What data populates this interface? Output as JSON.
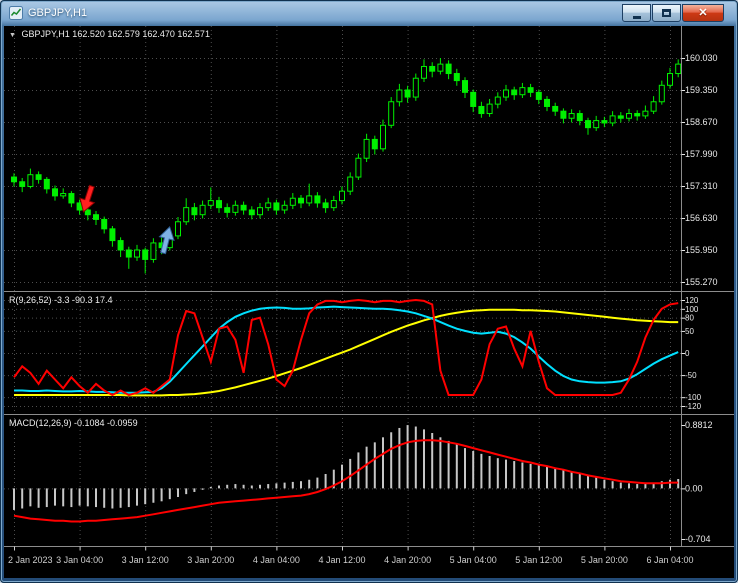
{
  "window": {
    "title": "GBPJPY,H1"
  },
  "icons": {
    "dropdown": "▼",
    "close": "✕"
  },
  "chart": {
    "info_line": "GBPJPY,H1 162.520 162.579 162.470 162.571"
  },
  "panels": {
    "indicator1": {
      "label": "R(9,26,52) -3.3 -90.3 17.4"
    },
    "macd": {
      "label": "MACD(12,26,9) -0.1084 -0.0959"
    }
  },
  "colors": {
    "up": "#00f000",
    "down": "#00f000",
    "line_red": "#ff0000",
    "line_cyan": "#00e0ff",
    "line_yellow": "#ffff00",
    "histogram": "#c8c8c8",
    "grid": "#4e4e4e",
    "separator": "#8c8c8c",
    "axis_text": "#e8e8e8",
    "time_text": "#d0d0d0",
    "sell_arrow": "#ff2020",
    "buy_arrow": "#7fb2e5"
  },
  "chart_data": {
    "type": "candlestick",
    "symbol": "GBPJPY",
    "timeframe": "H1",
    "x_ticks": [
      {
        "bar": 0,
        "label": "2 Jan 2023"
      },
      {
        "bar": 8,
        "label": "3 Jan 04:00"
      },
      {
        "bar": 16,
        "label": "3 Jan 12:00"
      },
      {
        "bar": 24,
        "label": "3 Jan 20:00"
      },
      {
        "bar": 32,
        "label": "4 Jan 04:00"
      },
      {
        "bar": 40,
        "label": "4 Jan 12:00"
      },
      {
        "bar": 48,
        "label": "4 Jan 20:00"
      },
      {
        "bar": 56,
        "label": "5 Jan 04:00"
      },
      {
        "bar": 64,
        "label": "5 Jan 12:00"
      },
      {
        "bar": 72,
        "label": "5 Jan 20:00"
      },
      {
        "bar": 80,
        "label": "6 Jan 04:00"
      }
    ],
    "main": {
      "y_labels": [
        "160.030",
        "159.350",
        "158.670",
        "157.990",
        "157.310",
        "156.630",
        "155.950",
        "155.270"
      ],
      "candles": [
        [
          157.5,
          157.58,
          157.3,
          157.4
        ],
        [
          157.4,
          157.48,
          157.18,
          157.3
        ],
        [
          157.3,
          157.68,
          157.26,
          157.55
        ],
        [
          157.55,
          157.62,
          157.36,
          157.45
        ],
        [
          157.45,
          157.5,
          157.15,
          157.25
        ],
        [
          157.25,
          157.32,
          157.0,
          157.1
        ],
        [
          157.1,
          157.26,
          157.04,
          157.15
        ],
        [
          157.15,
          157.2,
          156.86,
          156.95
        ],
        [
          156.95,
          157.02,
          156.7,
          156.8
        ],
        [
          156.8,
          156.88,
          156.58,
          156.7
        ],
        [
          156.7,
          156.78,
          156.48,
          156.6
        ],
        [
          156.6,
          156.66,
          156.3,
          156.4
        ],
        [
          156.4,
          156.46,
          156.02,
          156.15
        ],
        [
          156.15,
          156.22,
          155.8,
          155.95
        ],
        [
          155.95,
          156.02,
          155.55,
          155.8
        ],
        [
          155.8,
          156.06,
          155.72,
          155.95
        ],
        [
          155.95,
          156.0,
          155.45,
          155.75
        ],
        [
          155.75,
          156.2,
          155.68,
          156.1
        ],
        [
          156.1,
          156.22,
          155.86,
          156.0
        ],
        [
          156.0,
          156.36,
          155.94,
          156.25
        ],
        [
          156.25,
          156.65,
          156.18,
          156.55
        ],
        [
          156.55,
          157.05,
          156.48,
          156.85
        ],
        [
          156.85,
          156.95,
          156.58,
          156.7
        ],
        [
          156.7,
          157.0,
          156.62,
          156.9
        ],
        [
          156.9,
          157.28,
          156.82,
          157.0
        ],
        [
          157.0,
          157.08,
          156.74,
          156.85
        ],
        [
          156.85,
          156.94,
          156.64,
          156.75
        ],
        [
          156.75,
          157.0,
          156.68,
          156.9
        ],
        [
          156.9,
          156.98,
          156.7,
          156.8
        ],
        [
          156.8,
          156.88,
          156.6,
          156.7
        ],
        [
          156.7,
          156.95,
          156.62,
          156.85
        ],
        [
          156.85,
          157.06,
          156.78,
          156.95
        ],
        [
          156.95,
          157.02,
          156.7,
          156.8
        ],
        [
          156.8,
          157.0,
          156.72,
          156.9
        ],
        [
          156.9,
          157.16,
          156.82,
          157.05
        ],
        [
          157.05,
          157.12,
          156.84,
          156.95
        ],
        [
          156.95,
          157.36,
          156.88,
          157.1
        ],
        [
          157.1,
          157.18,
          156.85,
          156.95
        ],
        [
          156.95,
          157.04,
          156.74,
          156.85
        ],
        [
          156.85,
          157.1,
          156.78,
          157.0
        ],
        [
          157.0,
          157.3,
          156.92,
          157.2
        ],
        [
          157.2,
          157.6,
          157.12,
          157.5
        ],
        [
          157.5,
          158.0,
          157.44,
          157.9
        ],
        [
          157.9,
          158.42,
          157.82,
          158.3
        ],
        [
          158.3,
          158.38,
          157.98,
          158.1
        ],
        [
          158.1,
          158.72,
          158.04,
          158.6
        ],
        [
          158.6,
          159.2,
          158.54,
          159.1
        ],
        [
          159.1,
          159.48,
          159.0,
          159.35
        ],
        [
          159.35,
          159.44,
          159.08,
          159.2
        ],
        [
          159.2,
          159.7,
          159.12,
          159.6
        ],
        [
          159.6,
          160.0,
          159.52,
          159.85
        ],
        [
          159.85,
          159.94,
          159.62,
          159.75
        ],
        [
          159.75,
          160.03,
          159.68,
          159.9
        ],
        [
          159.9,
          159.98,
          159.58,
          159.7
        ],
        [
          159.7,
          159.8,
          159.44,
          159.55
        ],
        [
          159.55,
          159.62,
          159.18,
          159.3
        ],
        [
          159.3,
          159.36,
          158.88,
          159.0
        ],
        [
          159.0,
          159.1,
          158.76,
          158.85
        ],
        [
          158.85,
          159.16,
          158.78,
          159.05
        ],
        [
          159.05,
          159.3,
          158.96,
          159.2
        ],
        [
          159.2,
          159.46,
          159.12,
          159.35
        ],
        [
          159.35,
          159.42,
          159.14,
          159.25
        ],
        [
          159.25,
          159.5,
          159.18,
          159.4
        ],
        [
          159.4,
          159.48,
          159.2,
          159.3
        ],
        [
          159.3,
          159.36,
          159.05,
          159.15
        ],
        [
          159.15,
          159.22,
          158.9,
          159.0
        ],
        [
          159.0,
          159.08,
          158.8,
          158.9
        ],
        [
          158.9,
          158.96,
          158.64,
          158.75
        ],
        [
          158.75,
          158.94,
          158.66,
          158.85
        ],
        [
          158.85,
          158.92,
          158.6,
          158.7
        ],
        [
          158.7,
          158.76,
          158.4,
          158.55
        ],
        [
          158.55,
          158.8,
          158.48,
          158.7
        ],
        [
          158.7,
          158.78,
          158.56,
          158.65
        ],
        [
          158.65,
          158.9,
          158.58,
          158.8
        ],
        [
          158.8,
          158.88,
          158.66,
          158.75
        ],
        [
          158.75,
          158.95,
          158.68,
          158.85
        ],
        [
          158.85,
          158.92,
          158.7,
          158.8
        ],
        [
          158.8,
          159.02,
          158.74,
          158.9
        ],
        [
          158.9,
          159.22,
          158.84,
          159.1
        ],
        [
          159.1,
          159.55,
          159.04,
          159.45
        ],
        [
          159.45,
          159.82,
          159.38,
          159.7
        ],
        [
          159.7,
          160.0,
          159.62,
          159.9
        ]
      ]
    },
    "indicator1": {
      "levels": [
        120,
        100,
        80,
        50,
        0,
        -50,
        -100,
        -120
      ],
      "series": [
        {
          "name": "red",
          "color_key": "line_red",
          "values": [
            -55,
            -30,
            -45,
            -70,
            -40,
            -60,
            -80,
            -55,
            -75,
            -90,
            -70,
            -85,
            -95,
            -85,
            -95,
            -90,
            -80,
            -90,
            -75,
            -60,
            40,
            95,
            90,
            35,
            -20,
            55,
            60,
            30,
            -45,
            75,
            80,
            20,
            -60,
            -75,
            -40,
            30,
            90,
            110,
            118,
            118,
            115,
            118,
            120,
            118,
            115,
            118,
            118,
            115,
            118,
            120,
            118,
            110,
            -40,
            -95,
            -95,
            -95,
            -95,
            -60,
            20,
            55,
            60,
            10,
            -30,
            50,
            -20,
            -80,
            -95,
            -95,
            -95,
            -95,
            -95,
            -95,
            -95,
            -95,
            -90,
            -60,
            -20,
            35,
            75,
            100,
            110,
            113
          ]
        },
        {
          "name": "cyan",
          "color_key": "line_cyan",
          "values": [
            -85,
            -85,
            -86,
            -86,
            -85,
            -86,
            -87,
            -87,
            -86,
            -87,
            -88,
            -88,
            -89,
            -90,
            -90,
            -90,
            -89,
            -88,
            -80,
            -65,
            -45,
            -25,
            -5,
            15,
            35,
            55,
            70,
            82,
            90,
            96,
            100,
            102,
            103,
            102,
            100,
            100,
            101,
            103,
            104,
            105,
            104,
            103,
            102,
            101,
            100,
            100,
            99,
            97,
            94,
            90,
            84,
            78,
            70,
            62,
            55,
            50,
            46,
            44,
            46,
            48,
            44,
            36,
            24,
            10,
            -8,
            -25,
            -40,
            -52,
            -60,
            -64,
            -66,
            -67,
            -67,
            -66,
            -64,
            -58,
            -48,
            -36,
            -24,
            -14,
            -6,
            2
          ]
        },
        {
          "name": "yellow",
          "color_key": "line_yellow",
          "values": [
            -95,
            -95,
            -95,
            -95,
            -95,
            -95,
            -95,
            -95,
            -95,
            -95,
            -95,
            -95,
            -95,
            -95,
            -96,
            -96,
            -96,
            -96,
            -96,
            -95,
            -95,
            -94,
            -93,
            -91,
            -89,
            -86,
            -82,
            -78,
            -73,
            -68,
            -63,
            -58,
            -52,
            -46,
            -40,
            -34,
            -27,
            -20,
            -13,
            -6,
            1,
            8,
            16,
            24,
            32,
            40,
            48,
            55,
            62,
            68,
            74,
            79,
            84,
            88,
            91,
            94,
            96,
            97,
            98,
            98,
            98,
            98,
            97,
            97,
            96,
            95,
            94,
            92,
            90,
            88,
            86,
            84,
            82,
            80,
            78,
            76,
            74,
            73,
            72,
            71,
            70,
            70
          ]
        }
      ]
    },
    "macd": {
      "y_labels": [
        "0.8812",
        "0.00",
        "-0.704"
      ],
      "histogram": [
        -0.3,
        -0.28,
        -0.25,
        -0.27,
        -0.26,
        -0.24,
        -0.25,
        -0.26,
        -0.24,
        -0.25,
        -0.26,
        -0.27,
        -0.28,
        -0.27,
        -0.26,
        -0.24,
        -0.22,
        -0.2,
        -0.18,
        -0.15,
        -0.12,
        -0.08,
        -0.05,
        -0.02,
        0.02,
        0.04,
        0.05,
        0.06,
        0.05,
        0.04,
        0.05,
        0.06,
        0.07,
        0.08,
        0.09,
        0.1,
        0.12,
        0.15,
        0.2,
        0.26,
        0.33,
        0.41,
        0.5,
        0.58,
        0.64,
        0.71,
        0.78,
        0.84,
        0.88,
        0.86,
        0.82,
        0.77,
        0.71,
        0.66,
        0.61,
        0.56,
        0.52,
        0.48,
        0.45,
        0.42,
        0.4,
        0.38,
        0.36,
        0.34,
        0.32,
        0.3,
        0.28,
        0.26,
        0.24,
        0.21,
        0.18,
        0.15,
        0.12,
        0.1,
        0.08,
        0.07,
        0.06,
        0.07,
        0.08,
        0.1,
        0.12,
        0.13
      ],
      "signal": [
        -0.38,
        -0.4,
        -0.42,
        -0.43,
        -0.44,
        -0.45,
        -0.45,
        -0.46,
        -0.46,
        -0.45,
        -0.45,
        -0.44,
        -0.43,
        -0.42,
        -0.41,
        -0.4,
        -0.38,
        -0.36,
        -0.34,
        -0.32,
        -0.3,
        -0.28,
        -0.26,
        -0.24,
        -0.22,
        -0.2,
        -0.19,
        -0.18,
        -0.17,
        -0.16,
        -0.15,
        -0.14,
        -0.13,
        -0.12,
        -0.11,
        -0.1,
        -0.08,
        -0.05,
        -0.01,
        0.04,
        0.1,
        0.17,
        0.25,
        0.33,
        0.41,
        0.48,
        0.55,
        0.6,
        0.64,
        0.66,
        0.67,
        0.67,
        0.66,
        0.64,
        0.62,
        0.59,
        0.56,
        0.53,
        0.5,
        0.47,
        0.44,
        0.41,
        0.38,
        0.36,
        0.33,
        0.31,
        0.28,
        0.26,
        0.23,
        0.21,
        0.18,
        0.16,
        0.14,
        0.12,
        0.1,
        0.09,
        0.08,
        0.07,
        0.07,
        0.07,
        0.08,
        0.08
      ]
    },
    "annotations": [
      {
        "name": "sell-arrow",
        "bar": 9,
        "price": 157.32,
        "direction": "down",
        "color_key": "sell_arrow",
        "outline": "#8a0000",
        "tilt": 18
      },
      {
        "name": "buy-arrow",
        "bar": 18.6,
        "price": 156.45,
        "direction": "up",
        "color_key": "buy_arrow",
        "outline": "#2d5e93",
        "tilt": 14
      }
    ]
  }
}
